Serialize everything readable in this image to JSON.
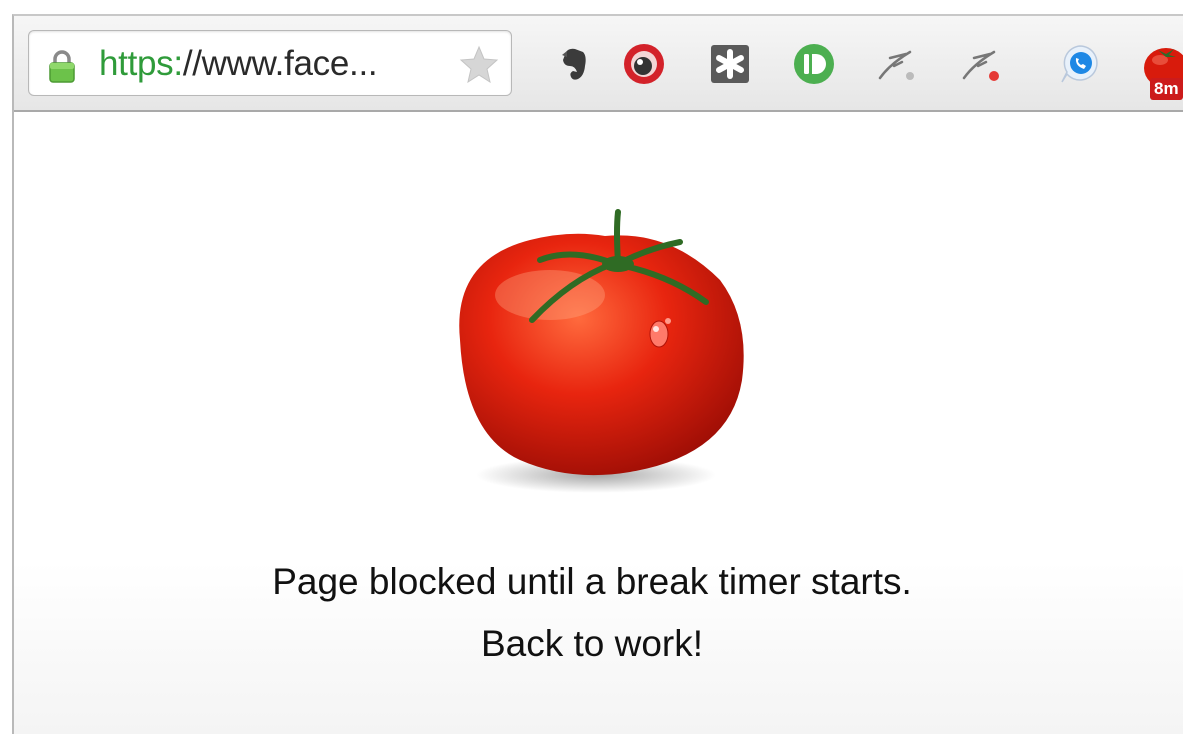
{
  "omnibox": {
    "scheme": "https:",
    "url_rest": "//www.face...",
    "secure": true
  },
  "extensions": [
    {
      "name": "evernote-icon"
    },
    {
      "name": "record-icon"
    },
    {
      "name": "asterisk-icon"
    },
    {
      "name": "pushbullet-icon"
    },
    {
      "name": "feather-icon"
    },
    {
      "name": "feather-red-icon"
    },
    {
      "name": "skype-icon"
    },
    {
      "name": "tomato-timer-icon",
      "badge": "8m"
    }
  ],
  "page": {
    "message_line1": "Page blocked until a break timer starts.",
    "message_line2": "Back to work!"
  },
  "colors": {
    "secure_green": "#2f9b3a",
    "tomato_red": "#d81b0c",
    "badge_red": "#cc1b1b"
  }
}
